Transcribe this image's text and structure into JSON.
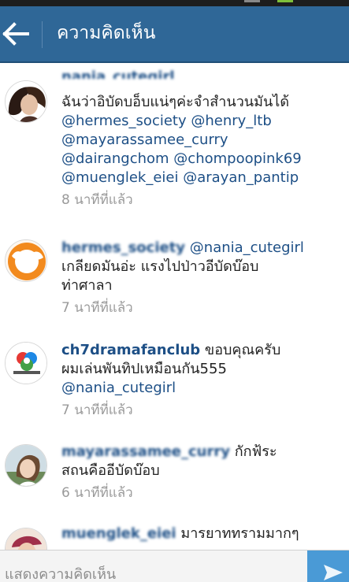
{
  "header": {
    "title": "ความคิดเห็น"
  },
  "comments": [
    {
      "username": "nania_cutegirl",
      "lines": [
        "ฉันว่าอิบัดบอ็บแน่ๆค่ะจำสำนวนมันได้",
        "@hermes_society @henry_ltb",
        "@mayarassamee_curry",
        "@dairangchom @chompoopink69",
        "@muenglek_eiei @arayan_pantip"
      ],
      "time": "8 นาทีที่แล้ว"
    },
    {
      "username": "hermes_society",
      "first_line_rest": "@nania_cutegirl",
      "lines": [
        "เกลียดมันอ่ะ แรงไปป่าวอีบัดบ๊อบ",
        "ท่าศาลา"
      ],
      "time": "7 นาทีที่แล้ว"
    },
    {
      "username": "ch7dramafanclub",
      "first_line_rest": "ขอบคุณครับ",
      "lines": [
        "ผมเล่นพันทิปเหมือนกัน555",
        "@nania_cutegirl"
      ],
      "time": "7 นาทีที่แล้ว"
    },
    {
      "username": "mayarassamee_curry",
      "first_line_rest": "กักฟ้ระ",
      "lines": [
        "สถนคืออีบัดบ๊อบ"
      ],
      "time": "6 นาทีที่แล้ว"
    },
    {
      "username": "muenglek_eiei",
      "first_line_rest": "มารยาททรามมากๆ"
    }
  ],
  "input": {
    "placeholder": "แสดงความคิดเห็น"
  },
  "colors": {
    "header_bg": "#2f6797",
    "link": "#1d4f86",
    "send_bg": "#4a9ad6",
    "timestamp": "#9a9a9a"
  },
  "icons": {
    "back": "arrow-left-icon",
    "send": "send-icon"
  }
}
